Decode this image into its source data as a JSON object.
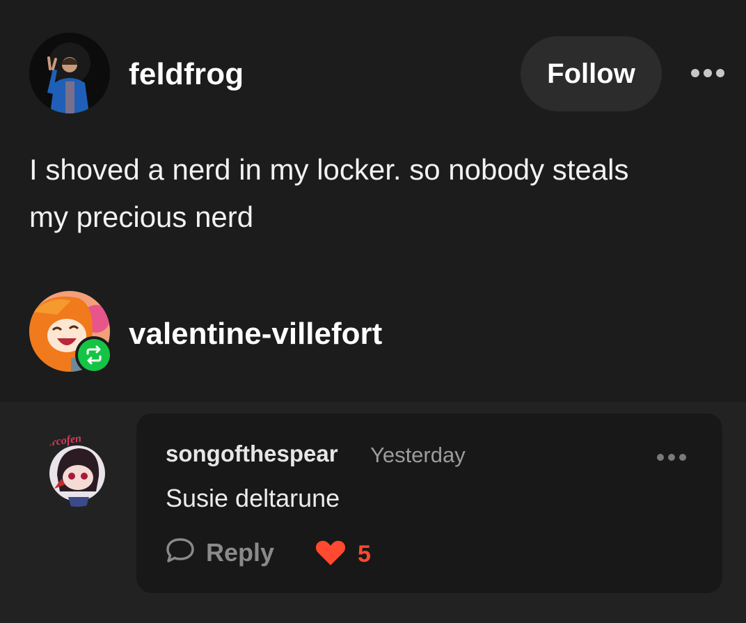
{
  "post": {
    "author": "feldfrog",
    "follow_label": "Follow",
    "more_icon": "more-horizontal-icon",
    "body_lines": [
      "I shoved a nerd in my locker. so nobody steals",
      "my precious nerd"
    ]
  },
  "reblog": {
    "username": "valentine-villefort",
    "badge_icon": "reblog-icon",
    "badge_color": "#15c444"
  },
  "reply": {
    "avatar_text": "forcofen",
    "username": "songofthespear",
    "timestamp": "Yesterday",
    "text": "Susie deltarune",
    "reply_label": "Reply",
    "reply_icon": "speech-bubble-icon",
    "like_icon": "heart-icon",
    "like_count": "5",
    "like_color": "#ff4930",
    "more_icon": "more-horizontal-icon"
  }
}
